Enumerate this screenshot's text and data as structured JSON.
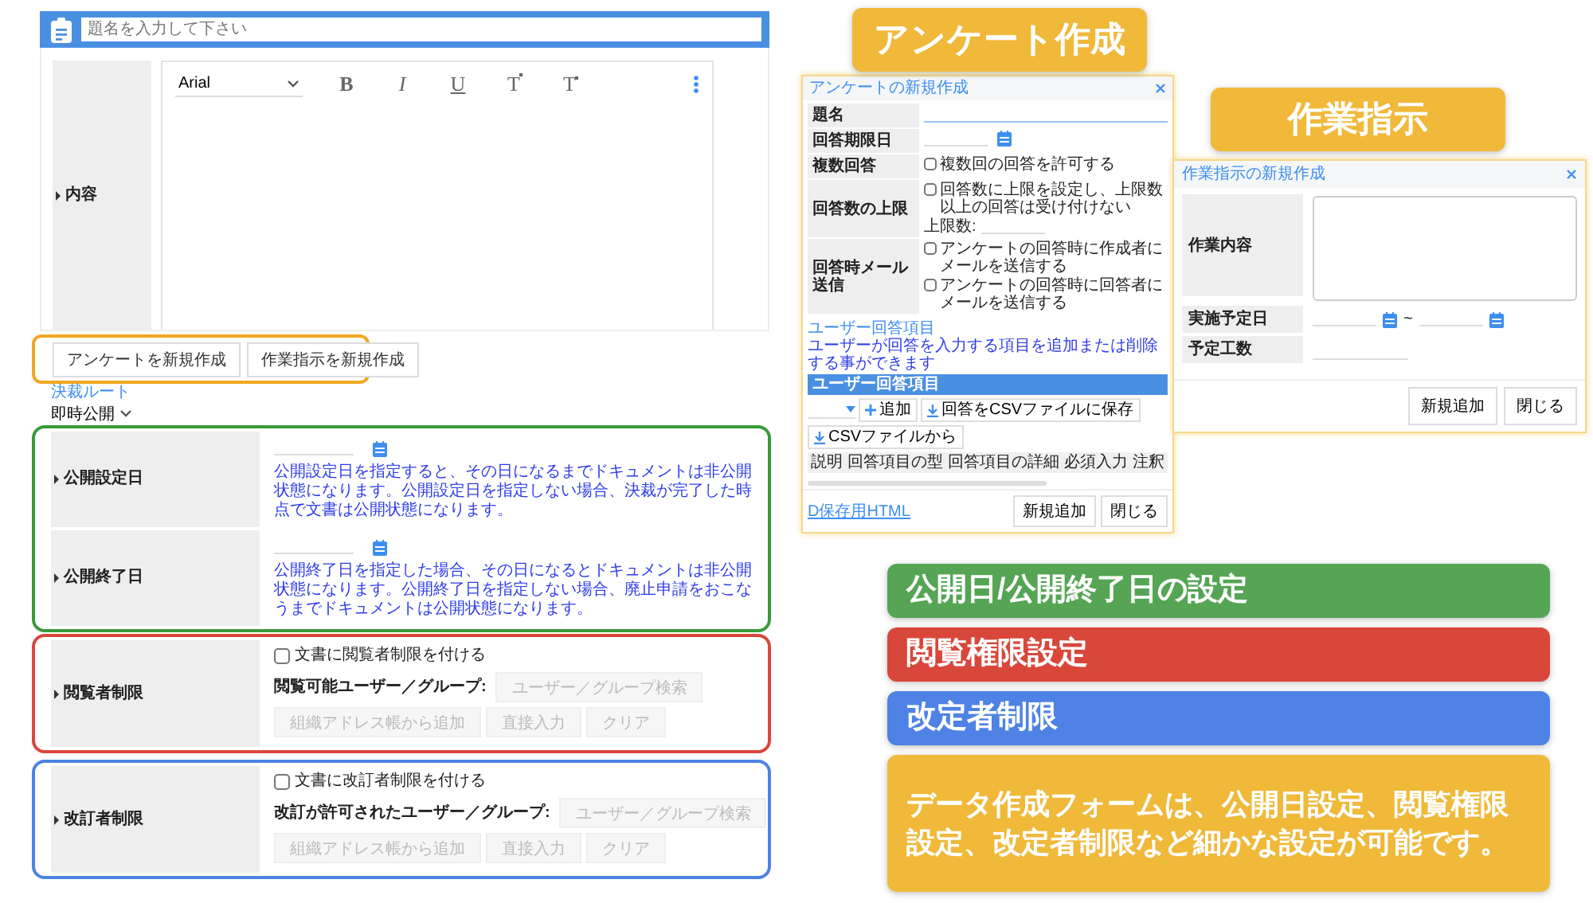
{
  "form": {
    "title_placeholder": "題名を入力して下さい",
    "content_label": "内容",
    "editor": {
      "font": "Arial",
      "format_buttons": [
        {
          "label": "B",
          "kind": "bold"
        },
        {
          "label": "I",
          "kind": "italic"
        },
        {
          "label": "U",
          "kind": "underline"
        },
        {
          "label": "T",
          "kind": "superscript"
        },
        {
          "label": "T",
          "kind": "subscript"
        }
      ]
    },
    "create_buttons": [
      "アンケートを新規作成",
      "作業指示を新規作成"
    ],
    "route_link": "決裁ルート",
    "publish_mode": "即時公開",
    "date_rows": [
      {
        "label": "公開設定日",
        "note": "公開設定日を指定すると、その日になるまでドキュメントは非公開状態になります。公開設定日を指定しない場合、決裁が完了した時点で文書は公開状態になります。"
      },
      {
        "label": "公開終了日",
        "note": "公開終了日を指定した場合、その日になるとドキュメントは非公開状態になります。公開終了日を指定しない場合、廃止申請をおこなうまでドキュメントは公開状態になります。"
      }
    ],
    "restriction_rows": [
      {
        "label": "閲覧者制限",
        "checkbox": "文書に閲覧者制限を付ける",
        "checked": false,
        "group_label": "閲覧可能ユーザー／グループ:",
        "search_button": "ユーザー／グループ検索",
        "buttons": [
          "組織アドレス帳から追加",
          "直接入力",
          "クリア"
        ],
        "disabled": true,
        "color": "#d9473a"
      },
      {
        "label": "改訂者制限",
        "checkbox": "文書に改訂者制限を付ける",
        "checked": false,
        "group_label": "改訂が許可されたユーザー／グループ:",
        "search_button": "ユーザー／グループ検索",
        "buttons": [
          "組織アドレス帳から追加",
          "直接入力",
          "クリア"
        ],
        "disabled": true,
        "color": "#4e82e4"
      }
    ]
  },
  "survey_window": {
    "title": "アンケートの新規作成",
    "rows": [
      {
        "label": "題名",
        "kind": "text"
      },
      {
        "label": "回答期限日",
        "kind": "date"
      },
      {
        "label": "複数回答",
        "kind": "checks",
        "options": [
          {
            "label": "複数回の回答を許可する",
            "checked": false
          }
        ]
      },
      {
        "label": "回答数の上限",
        "kind": "checks",
        "options": [
          {
            "label": "回答数に上限を設定し、上限数以上の回答は受け付けない",
            "checked": false
          }
        ],
        "limit_label": "上限数:"
      },
      {
        "label": "回答時メール送信",
        "kind": "checks",
        "options": [
          {
            "label": "アンケートの回答時に作成者にメールを送信する",
            "checked": false
          },
          {
            "label": "アンケートの回答時に回答者にメールを送信する",
            "checked": false
          }
        ]
      }
    ],
    "section_link": "ユーザー回答項目",
    "section_note": "ユーザーが回答を入力する項目を追加または削除する事ができます",
    "table_title": "ユーザー回答項目",
    "tools": [
      {
        "label": "追加",
        "kind": "add"
      },
      {
        "label": "回答をCSVファイルに保存",
        "kind": "save"
      },
      {
        "label": "CSVファイルから",
        "kind": "load"
      }
    ],
    "columns": [
      "説明",
      "回答項目の型",
      "回答項目の詳細",
      "必須入力",
      "注釈"
    ],
    "footer_link": "D保存用HTML",
    "buttons": [
      "新規追加",
      "閉じる"
    ]
  },
  "task_window": {
    "title": "作業指示の新規作成",
    "rows": [
      {
        "label": "作業内容",
        "kind": "textarea"
      },
      {
        "label": "実施予定日",
        "kind": "date_range",
        "separator": "~"
      },
      {
        "label": "予定工数",
        "kind": "text"
      }
    ],
    "buttons": [
      "新規追加",
      "閉じる"
    ]
  },
  "callouts": [
    {
      "text": "アンケート作成",
      "color": "#f0b93a"
    },
    {
      "text": "作業指示",
      "color": "#f0b93a"
    },
    {
      "text": "公開日/公開終了日の設定",
      "color": "#55a554"
    },
    {
      "text": "閲覧権限設定",
      "color": "#d9473a"
    },
    {
      "text": "改定者制限",
      "color": "#4e82e4"
    },
    {
      "text": "データ作成フォームは、公開日設定、閲覧権限設定、改定者制限など細かな設定が可能です。",
      "color": "#f0b93a"
    }
  ]
}
